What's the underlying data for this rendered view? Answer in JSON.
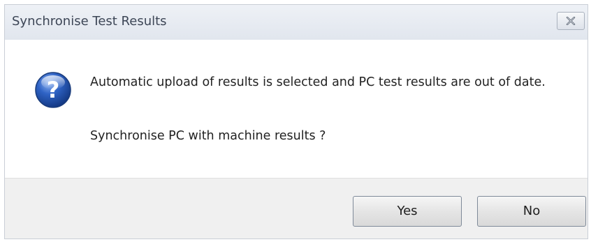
{
  "dialog": {
    "title": "Synchronise Test Results",
    "close_icon": "close-icon",
    "question_icon": "question-icon",
    "message": "Automatic upload of results is selected and PC test results are out of date.",
    "prompt": "Synchronise PC with machine results ?",
    "buttons": {
      "yes_label": "Yes",
      "no_label": "No"
    }
  }
}
